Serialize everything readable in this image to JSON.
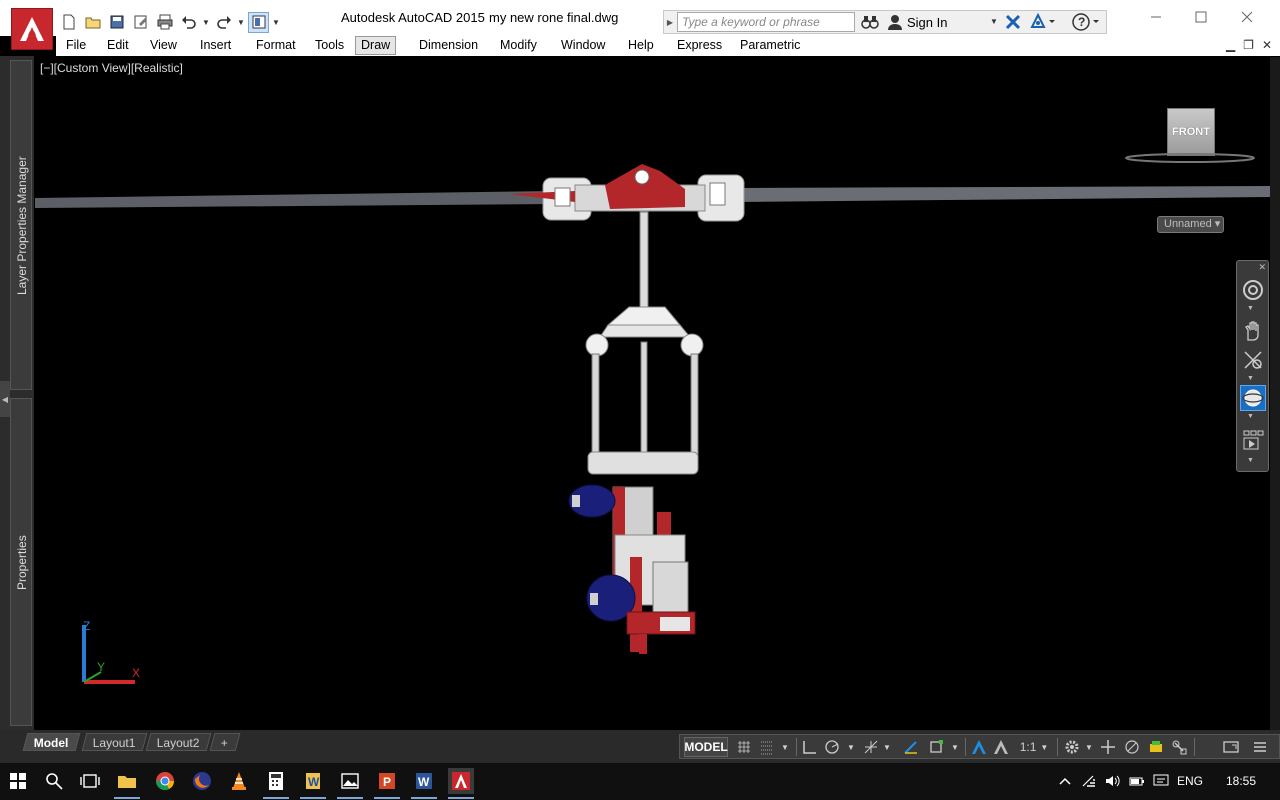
{
  "window": {
    "app_title": "Autodesk AutoCAD 2015",
    "file_name": "my new rone final.dwg"
  },
  "app_logo": {
    "letter": "A"
  },
  "infocenter": {
    "search_placeholder": "Type a keyword or phrase",
    "sign_in_label": "Sign In"
  },
  "menu": {
    "items": [
      "File",
      "Edit",
      "View",
      "Insert",
      "Format",
      "Tools",
      "Draw",
      "Dimension",
      "Modify",
      "Window",
      "Help",
      "Express",
      "Parametric"
    ],
    "active": "Draw"
  },
  "palettes": {
    "layer_properties_label": "Layer Properties Manager",
    "properties_label": "Properties"
  },
  "viewport": {
    "label": "[−][Custom View][Realistic]",
    "viewcube_face": "FRONT",
    "ucs_name": "Unnamed",
    "axis_z": "Z",
    "axis_y": "Y",
    "axis_x": "X"
  },
  "layout_tabs": {
    "items": [
      "Model",
      "Layout1",
      "Layout2"
    ],
    "active": "Model",
    "add_label": "+"
  },
  "status_bar": {
    "model_label": "MODEL",
    "annotation_scale": "1:1"
  },
  "tray": {
    "language": "ENG",
    "time": "18:55"
  },
  "colors": {
    "logo_red": "#c8282d",
    "viewport_bg": "#000000",
    "accent_blue": "#1b6fc2",
    "model_red": "#b3262a",
    "model_white": "#e8e8e8",
    "model_blue": "#1a1f7a"
  }
}
